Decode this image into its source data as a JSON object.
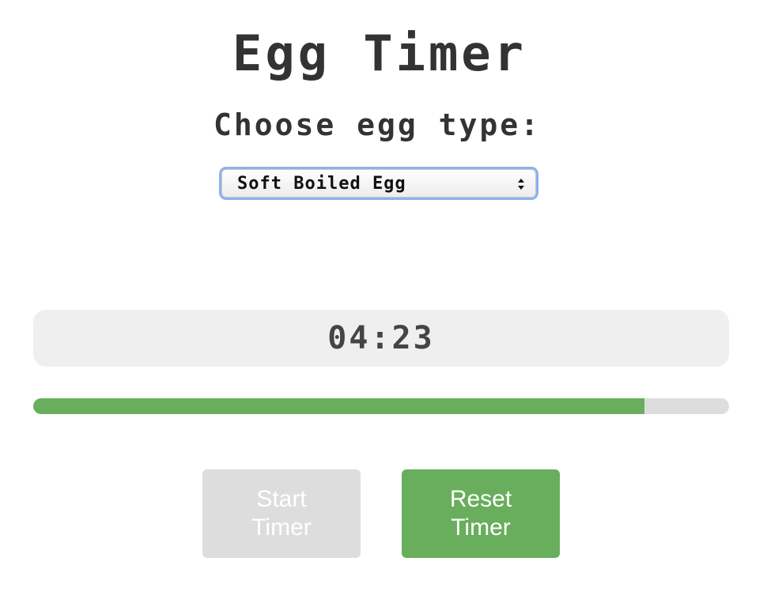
{
  "page": {
    "title": "Egg Timer",
    "subtitle": "Choose egg type:"
  },
  "egg_select": {
    "selected": "Soft Boiled Egg"
  },
  "timer": {
    "display": "04:23"
  },
  "progress": {
    "fraction": 0.878,
    "fill_color": "#68ae5c",
    "track_color": "#dddddd"
  },
  "buttons": {
    "start_label": "Start Timer",
    "start_state": "disabled",
    "reset_label": "Reset Timer"
  },
  "colors": {
    "accent": "#68ae5c",
    "disabled": "#dddddd",
    "text": "#333333",
    "focus_ring": "#8fb0f0"
  }
}
